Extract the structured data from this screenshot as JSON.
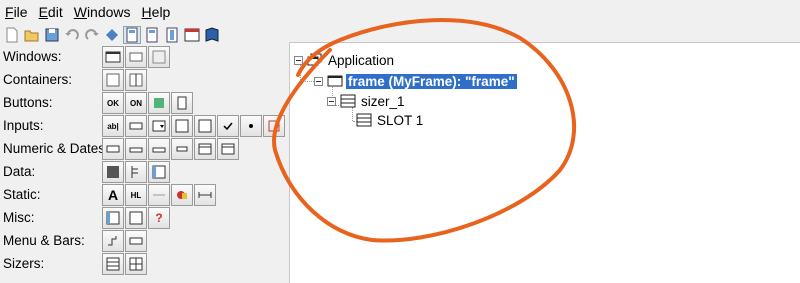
{
  "menubar": {
    "items": [
      {
        "accel": "F",
        "rest": "ile"
      },
      {
        "accel": "E",
        "rest": "dit"
      },
      {
        "accel": "W",
        "rest": "indows"
      },
      {
        "accel": "H",
        "rest": "elp"
      }
    ]
  },
  "toolbar": {
    "icons": [
      "new-file-icon",
      "open-folder-icon",
      "save-icon",
      "undo-icon",
      "redo-icon",
      "preview-icon",
      "layout-icon",
      "layout-2-icon",
      "layout-3-icon",
      "window-icon",
      "book-icon"
    ]
  },
  "palette": {
    "categories": [
      {
        "label": "Windows:",
        "buttons": 3
      },
      {
        "label": "Containers:",
        "buttons": 2
      },
      {
        "label": "Buttons:",
        "buttons": 4
      },
      {
        "label": "Inputs:",
        "buttons": 8
      },
      {
        "label": "Numeric & Dates:",
        "buttons": 6
      },
      {
        "label": "Data:",
        "buttons": 3
      },
      {
        "label": "Static:",
        "buttons": 5
      },
      {
        "label": "Misc:",
        "buttons": 3
      },
      {
        "label": "Menu & Bars:",
        "buttons": 2
      },
      {
        "label": "Sizers:",
        "buttons": 2
      }
    ],
    "button_texts": {
      "ok": "OK",
      "on": "ON",
      "ab": "ab|",
      "hl": "HL",
      "A": "A",
      "q": "?"
    }
  },
  "tree": {
    "root": "Application",
    "frame": "frame (MyFrame): \"frame\"",
    "sizer": "sizer_1",
    "slot": "SLOT 1"
  },
  "colors": {
    "selection": "#2f6fc9",
    "annotation": "#e8641e"
  }
}
